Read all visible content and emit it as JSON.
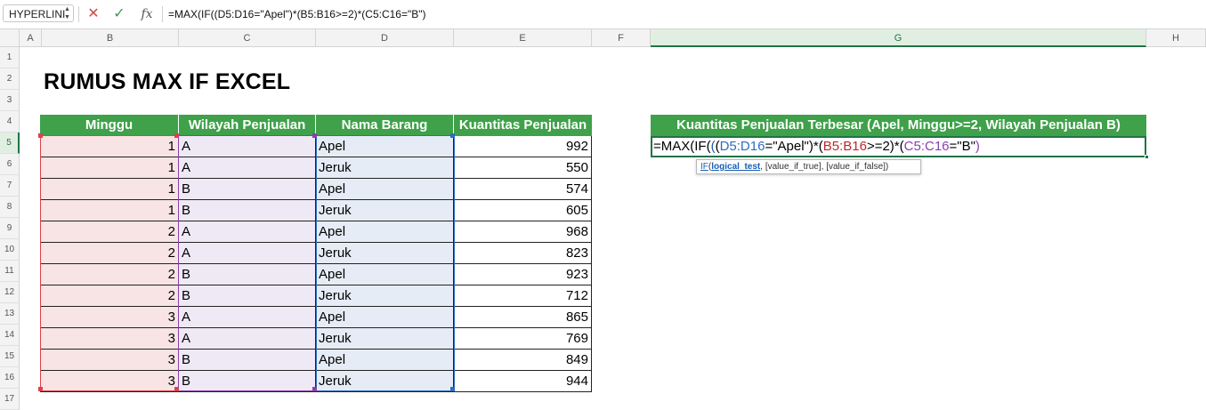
{
  "formula_bar": {
    "name_box": "HYPERLINI",
    "formula": "=MAX(IF((D5:D16=\"Apel\")*(B5:B16>=2)*(C5:C16=\"B\")"
  },
  "columns": [
    "A",
    "B",
    "C",
    "D",
    "E",
    "F",
    "G",
    "H"
  ],
  "rows": [
    "1",
    "2",
    "3",
    "4",
    "5",
    "6",
    "7",
    "8",
    "9",
    "10",
    "11",
    "12",
    "13",
    "14",
    "15",
    "16",
    "17"
  ],
  "title": "RUMUS MAX IF EXCEL",
  "table": {
    "headers": [
      "Minggu",
      "Wilayah Penjualan",
      "Nama Barang",
      "Kuantitas Penjualan"
    ],
    "rows": [
      [
        "1",
        "A",
        "Apel",
        "992"
      ],
      [
        "1",
        "A",
        "Jeruk",
        "550"
      ],
      [
        "1",
        "B",
        "Apel",
        "574"
      ],
      [
        "1",
        "B",
        "Jeruk",
        "605"
      ],
      [
        "2",
        "A",
        "Apel",
        "968"
      ],
      [
        "2",
        "A",
        "Jeruk",
        "823"
      ],
      [
        "2",
        "B",
        "Apel",
        "923"
      ],
      [
        "2",
        "B",
        "Jeruk",
        "712"
      ],
      [
        "3",
        "A",
        "Apel",
        "865"
      ],
      [
        "3",
        "A",
        "Jeruk",
        "769"
      ],
      [
        "3",
        "B",
        "Apel",
        "849"
      ],
      [
        "3",
        "B",
        "Jeruk",
        "944"
      ]
    ]
  },
  "result": {
    "header": "Kuantitas Penjualan Terbesar (Apel, Minggu>=2, Wilayah Penjualan B)",
    "formula_parts": [
      {
        "text": "=MAX(IF(",
        "color": "#000000"
      },
      {
        "text": "(",
        "color": "#1a5fb4"
      },
      {
        "text": "(",
        "color": "#000000"
      },
      {
        "text": "D5:D16",
        "color": "#2f6cc0"
      },
      {
        "text": "=\"Apel\")*(",
        "color": "#000000"
      },
      {
        "text": "B5:B16",
        "color": "#c0282d"
      },
      {
        "text": ">=2)*(",
        "color": "#000000"
      },
      {
        "text": "C5:C16",
        "color": "#8a3fb0"
      },
      {
        "text": "=\"B\"",
        "color": "#000000"
      },
      {
        "text": ")",
        "color": "#8a3fb0"
      }
    ]
  },
  "tooltip": {
    "fn": "IF",
    "open": "(",
    "arg1": "logical_test",
    "rest": ", [value_if_true], [value_if_false])"
  },
  "colors": {
    "header_green": "#3fa14a",
    "selection_green": "#217346",
    "range_b": "#d9444c",
    "range_c": "#8a3fb0",
    "range_d": "#2f6cc0"
  }
}
